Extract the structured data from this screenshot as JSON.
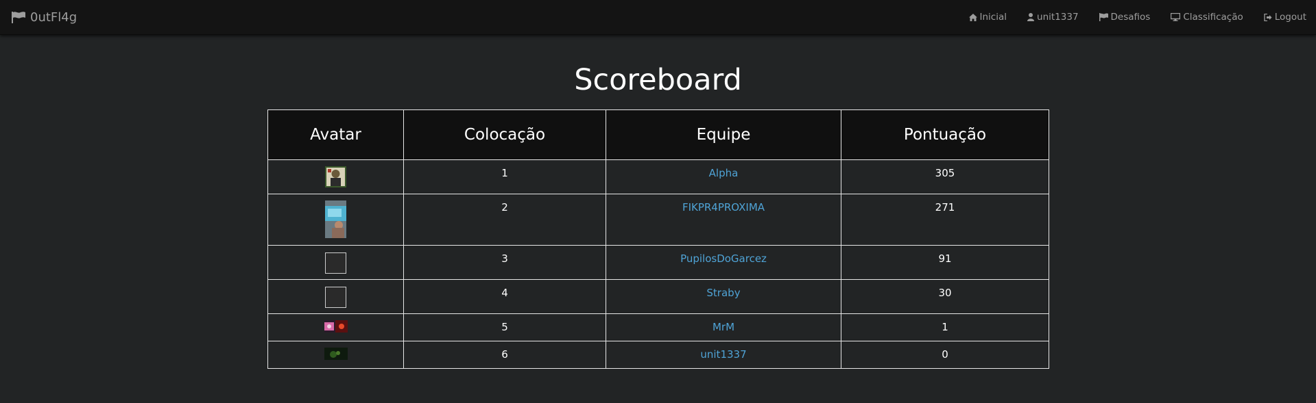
{
  "nav": {
    "brand": "0utFl4g",
    "links": [
      {
        "label": "Inicial",
        "icon": "home-icon"
      },
      {
        "label": "unit1337",
        "icon": "user-icon"
      },
      {
        "label": "Desafios",
        "icon": "flag-icon"
      },
      {
        "label": "Classificação",
        "icon": "desktop-icon"
      },
      {
        "label": "Logout",
        "icon": "logout-icon"
      }
    ]
  },
  "page": {
    "title": "Scoreboard"
  },
  "table": {
    "headers": [
      "Avatar",
      "Colocação",
      "Equipe",
      "Pontuação"
    ],
    "rows": [
      {
        "rank": "1",
        "team": "Alpha",
        "score": "305",
        "avatar": "image"
      },
      {
        "rank": "2",
        "team": "FIKPR4PROXIMA",
        "score": "271",
        "avatar": "image"
      },
      {
        "rank": "3",
        "team": "PupilosDoGarcez",
        "score": "91",
        "avatar": "broken"
      },
      {
        "rank": "4",
        "team": "Straby",
        "score": "30",
        "avatar": "broken"
      },
      {
        "rank": "5",
        "team": "MrM",
        "score": "1",
        "avatar": "image"
      },
      {
        "rank": "6",
        "team": "unit1337",
        "score": "0",
        "avatar": "image"
      }
    ]
  },
  "colors": {
    "background": "#222425",
    "navbar": "#141414",
    "link": "#4fa3d6",
    "muted": "#9d9d9d"
  }
}
